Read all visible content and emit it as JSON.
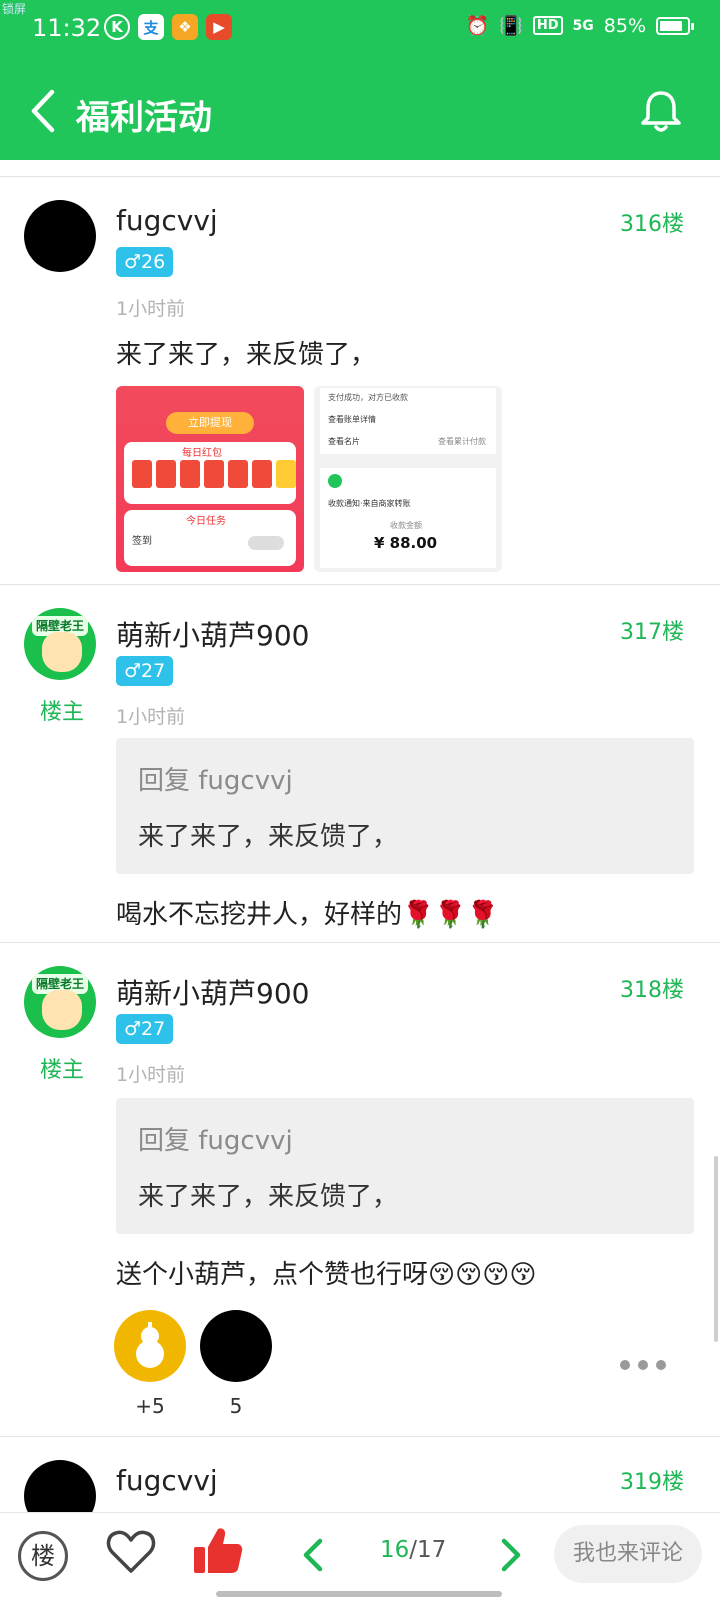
{
  "status_bar": {
    "time": "11:32",
    "tiny_label": "锁屏",
    "battery": "85%",
    "network": "5G",
    "hd": "HD",
    "battery_level": 0.85
  },
  "header": {
    "title": "福利活动",
    "back_icon": "chevron-left-icon",
    "bell_icon": "bell-icon"
  },
  "posts": [
    {
      "username": "fugcvvj",
      "gender": "♂",
      "level": "26",
      "time": "1小时前",
      "floor": "316楼",
      "content": "来了来了，来反馈了，",
      "images": [
        {
          "kind": "app-screenshot",
          "texts": [
            "立即提现",
            "每日红包",
            "今日任务",
            "签到"
          ]
        },
        {
          "kind": "payment-screenshot",
          "texts": [
            "支付成功，对方已收款",
            "查看账单详情",
            "查看名片",
            "查看累计付款",
            "收款通知·来自商家转账",
            "收款金额",
            "¥ 88.00"
          ]
        }
      ]
    },
    {
      "username": "萌新小葫芦900",
      "is_op": true,
      "op_label": "楼主",
      "gender": "♂",
      "level": "27",
      "time": "1小时前",
      "floor": "317楼",
      "quote": {
        "title": "回复 fugcvvj",
        "text": "来了来了，来反馈了，"
      },
      "content": "喝水不忘挖井人，好样的🌹🌹🌹"
    },
    {
      "username": "萌新小葫芦900",
      "is_op": true,
      "op_label": "楼主",
      "gender": "♂",
      "level": "27",
      "time": "1小时前",
      "floor": "318楼",
      "quote": {
        "title": "回复 fugcvvj",
        "text": "来了来了，来反馈了，"
      },
      "content": "送个小葫芦，点个赞也行呀😚😚😚😚",
      "gifts": [
        {
          "icon": "gourd-icon",
          "count": "+5"
        },
        {
          "icon": "avatar",
          "count": "5"
        }
      ]
    },
    {
      "username": "fugcvvj",
      "floor": "319楼"
    }
  ],
  "bottom_bar": {
    "floor_label": "楼",
    "page_current": "16",
    "page_separator": "/",
    "page_total": "17",
    "comment_placeholder": "我也来评论"
  },
  "colors": {
    "brand_green": "#21c65a",
    "badge_blue": "#2ec1ea",
    "like_red": "#e8322f",
    "gourd_yellow": "#f1b600"
  }
}
